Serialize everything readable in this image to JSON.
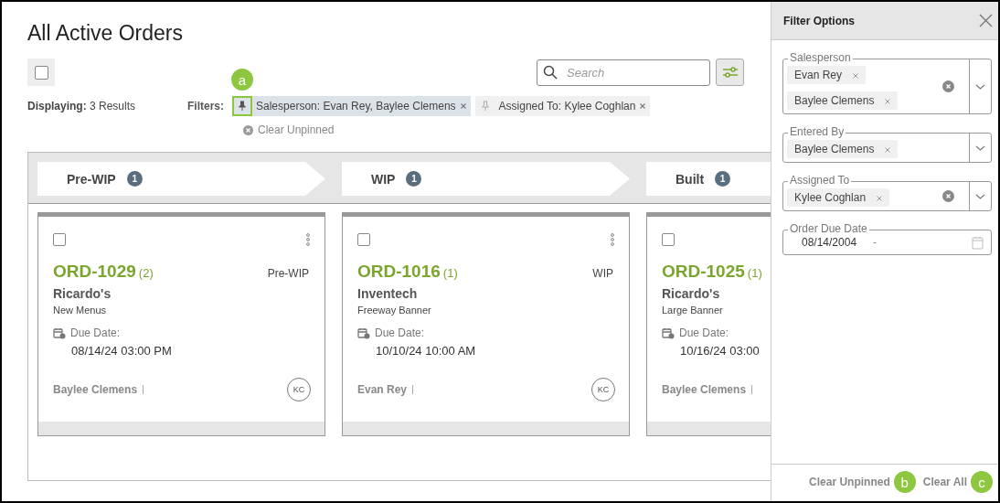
{
  "page": {
    "title": "All Active Orders",
    "select_all_checked": false,
    "search_placeholder": "Search",
    "displaying": "**Displaying:** 3 Results",
    "filters_label": "Filters:",
    "clear_unpinned": "Clear Unpinned"
  },
  "filters": [
    {
      "label": "Salesperson: Evan Rey, Baylee Clemens",
      "pinned": true,
      "callout": "a"
    },
    {
      "label": "Assigned To: Kylee Coghlan",
      "pinned": false
    }
  ],
  "columns": [
    {
      "name": "Pre-WIP",
      "count": "1",
      "cards": [
        {
          "checked": false,
          "order": "ORD-1029",
          "qty": "(2)",
          "status": "Pre-WIP",
          "customer": "Ricardo's",
          "job": "New Menus",
          "due_label": "Due Date:",
          "due": "08/14/24 03:00 PM",
          "salesperson": "Baylee Clemens",
          "assignee": "KC"
        }
      ]
    },
    {
      "name": "WIP",
      "count": "1",
      "cards": [
        {
          "checked": false,
          "order": "ORD-1016",
          "qty": "(1)",
          "status": "WIP",
          "customer": "Inventech",
          "job": "Freeway Banner",
          "due_label": "Due Date:",
          "due": "10/10/24 10:00 AM",
          "salesperson": "Evan Rey",
          "assignee": "KC"
        }
      ]
    },
    {
      "name": "Built",
      "count": "1",
      "cards": [
        {
          "checked": false,
          "order": "ORD-1025",
          "qty": "(1)",
          "customer": "Ricardo's",
          "job": "Large Banner",
          "due_label": "Due Date:",
          "due": "10/16/24 03:00",
          "salesperson": "Baylee Clemens"
        }
      ]
    }
  ],
  "panel": {
    "title": "Filter Options",
    "fields": [
      {
        "kind": "multi",
        "label": "Salesperson",
        "values": [
          "Evan Rey",
          "Baylee Clemens"
        ],
        "clearable": true
      },
      {
        "kind": "multi",
        "label": "Entered By",
        "values": [
          "Baylee Clemens"
        ],
        "clearable": false
      },
      {
        "kind": "multi",
        "label": "Assigned To",
        "values": [
          "Kylee Coghlan"
        ],
        "clearable": true
      },
      {
        "kind": "date",
        "label": "Order Due Date",
        "value": "08/14/2004",
        "separator": "-"
      }
    ],
    "footer": [
      {
        "label": "Clear Unpinned",
        "callout": "b"
      },
      {
        "label": "Clear All",
        "callout": "c"
      }
    ]
  }
}
